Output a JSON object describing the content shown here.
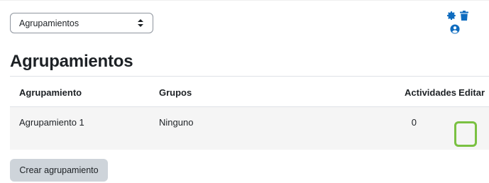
{
  "view_select": {
    "selected": "Agrupamientos"
  },
  "heading": "Agrupamientos",
  "table": {
    "columns": {
      "name": "Agrupamiento",
      "groups": "Grupos",
      "activities": "Actividades",
      "edit": "Editar"
    },
    "rows": [
      {
        "name": "Agrupamiento 1",
        "groups": "Ninguno",
        "activities": "0"
      }
    ]
  },
  "create_button": "Crear agrupamiento",
  "colors": {
    "accent": "#0f6cbf",
    "highlight": "#7ac142",
    "button_bg": "#ced4da",
    "row_bg": "#f5f5f5"
  },
  "icons": {
    "edit": "gear-icon",
    "delete": "trash-icon",
    "members": "user-circle-icon"
  }
}
